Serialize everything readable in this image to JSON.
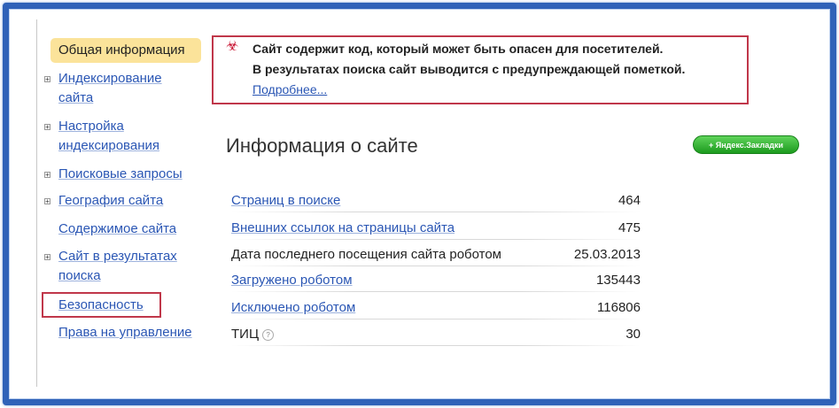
{
  "sidebar": {
    "active": "Общая информация",
    "items": [
      {
        "line1": "Индексирование",
        "line2": "сайта"
      },
      {
        "line1": "Настройка",
        "line2": "индексирования"
      },
      {
        "line1": "Поисковые запросы"
      },
      {
        "line1": "География сайта"
      },
      {
        "line1": "Содержимое сайта"
      },
      {
        "line1": "Сайт в результатах",
        "line2": "поиска"
      },
      {
        "line1": "Безопасность"
      },
      {
        "line1": "Права на управление"
      }
    ]
  },
  "warning": {
    "line1": "Сайт содержит код, который может быть опасен для посетителей.",
    "line2": "В результатах поиска сайт выводится с предупреждающей пометкой.",
    "more": "Подробнее...",
    "icon": "biohazard-icon",
    "color": "#c0374a"
  },
  "main": {
    "title": "Информация о сайте",
    "badge": "+ Яндекс.Закладки"
  },
  "stats": [
    {
      "label": "Страниц в поиске",
      "value": "464"
    },
    {
      "label": "Внешних ссылок на страницы сайта",
      "value": "475"
    },
    {
      "label": "Дата последнего посещения сайта роботом",
      "value": "25.03.2013"
    },
    {
      "label": "Загружено роботом",
      "value": "135443"
    },
    {
      "label": "Исключено роботом",
      "value": "116806"
    },
    {
      "label": "ТИЦ",
      "value": "30"
    }
  ],
  "colors": {
    "frame": "#2f62b8",
    "link": "#2a56b4",
    "active_bg": "#fbe39a",
    "button": "#1c9a1e"
  }
}
